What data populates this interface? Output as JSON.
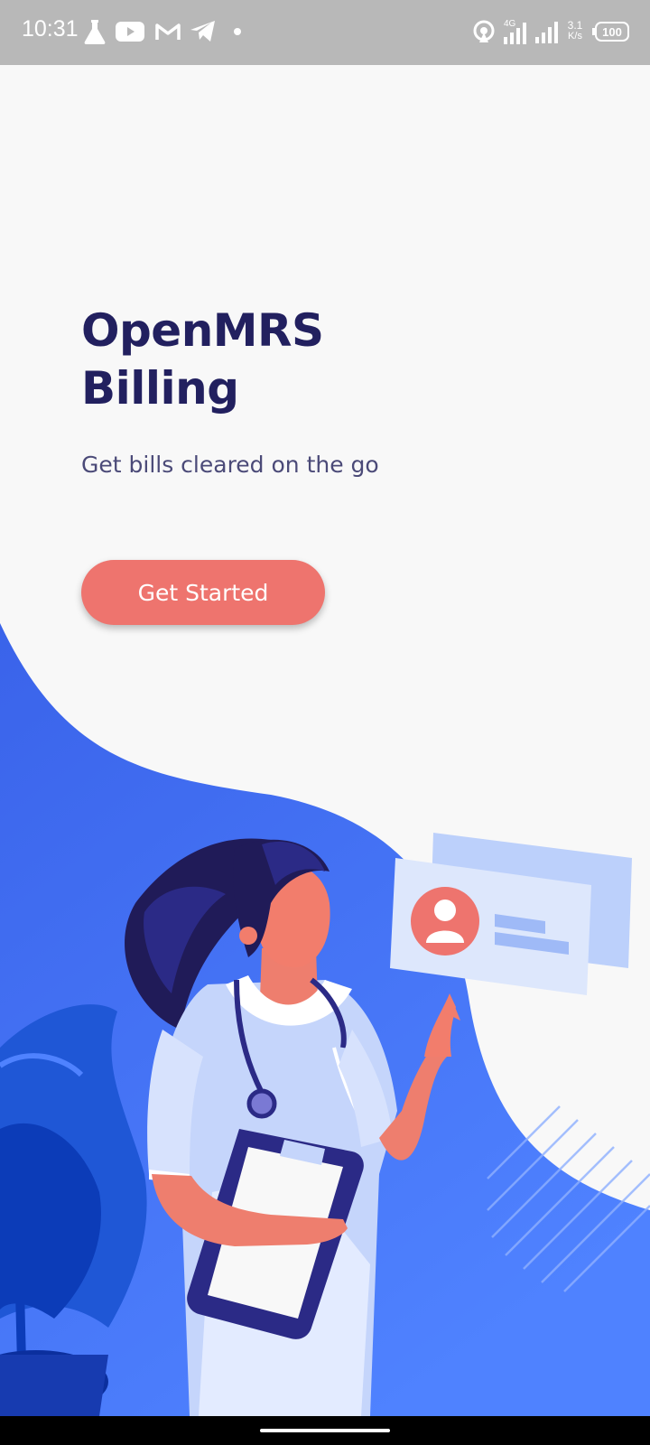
{
  "status_bar": {
    "time": "10:31",
    "network_label": "4G",
    "speed_value": "3.1",
    "speed_unit": "K/s",
    "battery": "100",
    "left_icons": [
      "flask-icon",
      "youtube-icon",
      "gmail-icon",
      "telegram-icon",
      "dot-icon"
    ],
    "right_icons": [
      "hotspot-icon",
      "signal-4g-icon",
      "signal-icon",
      "battery-icon"
    ]
  },
  "welcome": {
    "title_line1": "OpenMRS",
    "title_line2": "Billing",
    "tagline": "Get bills cleared on the go",
    "cta_label": "Get Started"
  },
  "colors": {
    "title": "#22205f",
    "tagline": "#4b4a78",
    "accent": "#ee746e",
    "wave_blue": "#3d6ff2",
    "background": "#f8f8f8",
    "status_bar": "#b8b8b8"
  }
}
